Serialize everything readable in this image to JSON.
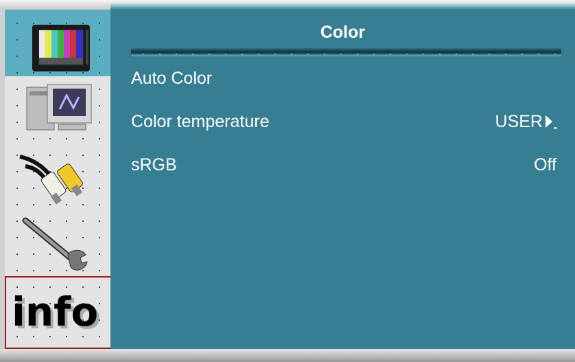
{
  "menu": {
    "title": "Color",
    "items": [
      {
        "label": "Auto Color",
        "value": ""
      },
      {
        "label": "Color temperature",
        "value": "USER"
      },
      {
        "label": "sRGB",
        "value": "Off"
      }
    ]
  },
  "sidebar": {
    "items": [
      {
        "name": "color",
        "icon": "tv-color-bars-icon",
        "active": true
      },
      {
        "name": "computer",
        "icon": "computer-icon",
        "active": false
      },
      {
        "name": "input",
        "icon": "rca-cable-icon",
        "active": false
      },
      {
        "name": "setup",
        "icon": "wrench-icon",
        "active": false
      },
      {
        "name": "info",
        "icon": "info-icon",
        "label": "info",
        "active": false
      }
    ]
  },
  "colors": {
    "panel": "#377e93",
    "active_item": "#5aaec0",
    "sidebar": "#e3e3e3",
    "text": "#ffffff"
  }
}
